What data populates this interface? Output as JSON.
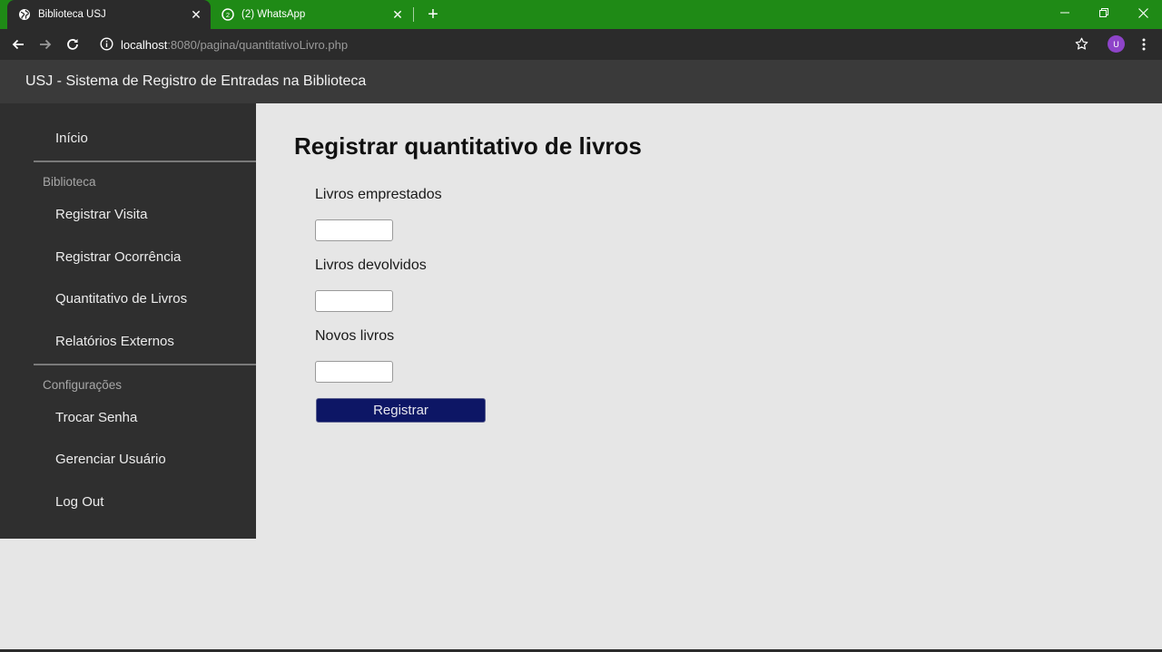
{
  "browser": {
    "tabs": [
      {
        "title": "Biblioteca USJ",
        "icon": "globe-icon",
        "active": true
      },
      {
        "title": "(2) WhatsApp",
        "icon": "whatsapp-icon",
        "active": false
      }
    ],
    "url_host": "localhost",
    "url_path": ":8080/pagina/quantitativoLivro.php",
    "profile_initial": "U",
    "colors": {
      "tabbar": "#1f8a16",
      "toolbar": "#2b2b2b",
      "profile": "#8e44c9"
    }
  },
  "header": {
    "title": "USJ - Sistema de Registro de Entradas na Biblioteca"
  },
  "sidebar": {
    "home": "Início",
    "sections": [
      {
        "title": "Biblioteca",
        "items": [
          "Registrar Visita",
          "Registrar Ocorrência",
          "Quantitativo de Livros",
          "Relatórios Externos"
        ]
      },
      {
        "title": "Configurações",
        "items": [
          "Trocar Senha",
          "Gerenciar Usuário",
          "Log Out"
        ]
      }
    ]
  },
  "form": {
    "title": "Registrar quantitativo de livros",
    "fields": [
      {
        "label": "Livros emprestados",
        "value": ""
      },
      {
        "label": "Livros devolvidos",
        "value": ""
      },
      {
        "label": "Novos livros",
        "value": ""
      }
    ],
    "submit_label": "Registrar",
    "submit_color": "#0d1665"
  }
}
